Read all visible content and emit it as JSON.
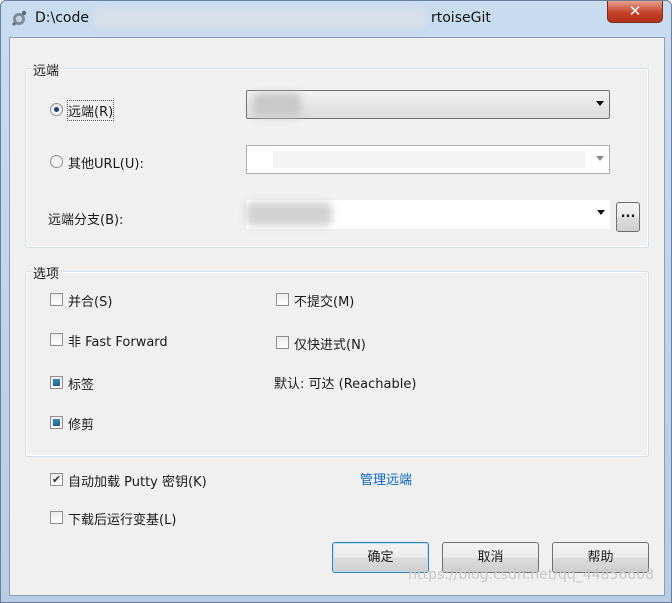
{
  "window": {
    "title_prefix": "D:\\code",
    "title_suffix": "rtoiseGit",
    "close_label": "✕"
  },
  "remote_group": {
    "title": "远端",
    "remote_radio_label": "远端(R)",
    "other_url_label": "其他URL(U):",
    "remote_branch_label": "远端分支(B):",
    "ellipsis_label": "..."
  },
  "options_group": {
    "title": "选项",
    "merge_label": "并合(S)",
    "no_commit_label": "不提交(M)",
    "no_ff_label": "非 Fast Forward",
    "ff_only_label": "仅快进式(N)",
    "tags_label": "标签",
    "default_reachable": "默认: 可达 (Reachable)",
    "prune_label": "修剪"
  },
  "bottom": {
    "autoload_putty_label": "自动加载 Putty 密钥(K)",
    "manage_remotes_link": "管理远端",
    "rebase_after_label": "下载后运行变基(L)",
    "ok_label": "确定",
    "cancel_label": "取消",
    "help_label": "帮助"
  },
  "watermark": "https://blog.csdn.net/qq_44856608"
}
